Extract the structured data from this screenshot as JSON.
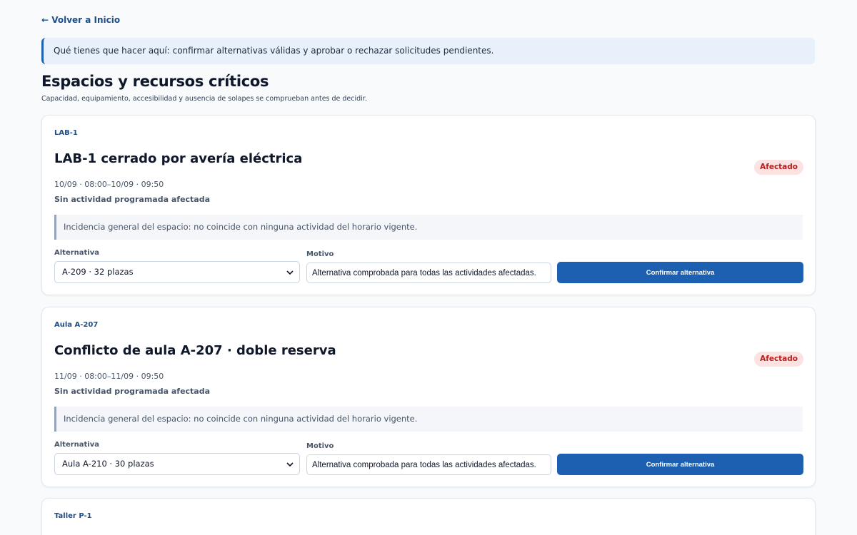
{
  "nav": {
    "back_label": "← Volver a Inicio"
  },
  "banner": {
    "text": "Qué tienes que hacer aquí: confirmar alternativas válidas y aprobar o rechazar solicitudes pendientes."
  },
  "header": {
    "title": "Espacios y recursos críticos",
    "subtitle": "Capacidad, equipamiento, accesibilidad y ausencia de solapes se comprueban antes de decidir."
  },
  "labels": {
    "alternative": "Alternativa",
    "reason": "Motivo",
    "confirm": "Confirmar alternativa"
  },
  "colors": {
    "accent": "#1d5fb0",
    "badge_bg": "#fde2e2",
    "badge_text": "#b91c1c"
  },
  "cards": [
    {
      "tag": "LAB-1",
      "title": "LAB-1 cerrado por avería eléctrica",
      "status": "Afectado",
      "date": "10/09 · 08:00–10/09 · 09:50",
      "affect": "Sin actividad programada afectada",
      "incidence": "Incidencia general del espacio: no coincide con ninguna actividad del horario vigente.",
      "alternative": "A-209 · 32 plazas",
      "reason": "Alternativa comprobada para todas las actividades afectadas."
    },
    {
      "tag": "Aula A-207",
      "title": "Conflicto de aula A-207 · doble reserva",
      "status": "Afectado",
      "date": "11/09 · 08:00–11/09 · 09:50",
      "affect": "Sin actividad programada afectada",
      "incidence": "Incidencia general del espacio: no coincide con ninguna actividad del horario vigente.",
      "alternative": "Aula A-210 · 30 plazas",
      "reason": "Alternativa comprobada para todas las actividades afectadas."
    },
    {
      "tag": "Taller P-1"
    }
  ]
}
